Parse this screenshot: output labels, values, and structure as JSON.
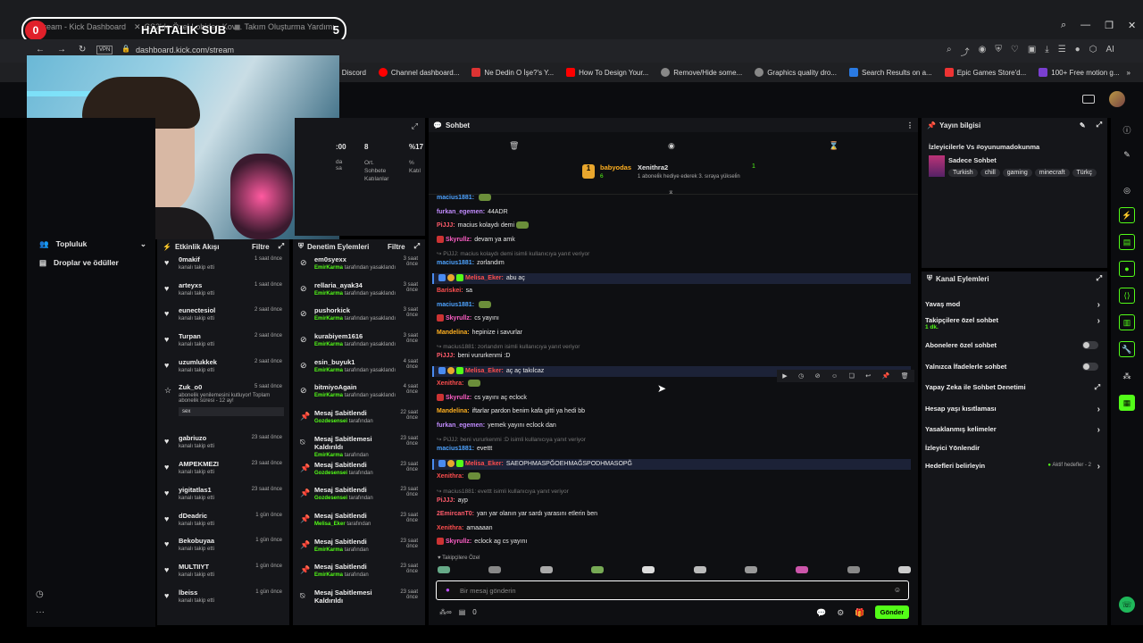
{
  "browser": {
    "tabs": [
      "stream - Kick Dashboard",
      "CS2'de Özel Lobiden Kov...",
      "Takım Oluşturma Yardımı"
    ],
    "url": "dashboard.kick.com/stream",
    "vpn_label": "VPN",
    "ai_label": "AI",
    "bookmarks": [
      "Discord",
      "Channel dashboard...",
      "Ne Dedin O İşe?'s Y...",
      "How To Design Your...",
      "Remove/Hide some...",
      "Graphics quality dro...",
      "Search Results on a...",
      "Epic Games Store'd...",
      "100+ Free motion g..."
    ]
  },
  "overlay": {
    "sub_count": "0",
    "label": "HAFTALIK SUB",
    "target": "5"
  },
  "stats": {
    "values": [
      ":00",
      "8",
      "%17"
    ],
    "labels": [
      "da\nsa",
      "Ort.\nSohbete\nKatılanlar",
      "%\nKatıl"
    ]
  },
  "left_nav": {
    "items": [
      "Topluluk",
      "Droplar ve ödüller"
    ]
  },
  "activity": {
    "title": "Etkinlik Akışı",
    "filter": "Filtre",
    "rows": [
      {
        "name": "0makif",
        "sub": "kanalı takip etti",
        "time": "1 saat önce"
      },
      {
        "name": "arteyxs",
        "sub": "kanalı takip etti",
        "time": "1 saat önce"
      },
      {
        "name": "eunectesiol",
        "sub": "kanalı takip etti",
        "time": "2 saat önce"
      },
      {
        "name": "Turpan",
        "sub": "kanalı takip etti",
        "time": "2 saat önce"
      },
      {
        "name": "uzumlukkek",
        "sub": "kanalı takip etti",
        "time": "2 saat önce"
      },
      {
        "name": "Zuk_o0",
        "sub": "abonelik yenilemesini kutluyor! Toplam abonelik süresi - 12 ay!",
        "time": "5 saat önce",
        "extra": "sex"
      },
      {
        "name": "gabriuzo",
        "sub": "kanalı takip etti",
        "time": "23 saat önce"
      },
      {
        "name": "AMPEKMEZI",
        "sub": "kanalı takip etti",
        "time": "23 saat önce"
      },
      {
        "name": "yigitatlas1",
        "sub": "kanalı takip etti",
        "time": "23 saat önce"
      },
      {
        "name": "dDeadric",
        "sub": "kanalı takip etti",
        "time": "1 gün önce"
      },
      {
        "name": "Bekobuyaa",
        "sub": "kanalı takip etti",
        "time": "1 gün önce"
      },
      {
        "name": "MULTIIYT",
        "sub": "kanalı takip etti",
        "time": "1 gün önce"
      },
      {
        "name": "lbeiss",
        "sub": "kanalı takip etti",
        "time": "1 gün önce"
      }
    ]
  },
  "moderation": {
    "title": "Denetim Eylemleri",
    "filter": "Filtre",
    "rows": [
      {
        "name": "em0syexx",
        "mod": "EmirKarma",
        "sub": "tarafından yasaklandı",
        "time": "3 saat önce",
        "icon": "ban"
      },
      {
        "name": "rellaria_ayak34",
        "mod": "EmirKarma",
        "sub": "tarafından yasaklandı",
        "time": "3 saat önce",
        "icon": "ban"
      },
      {
        "name": "pushorkick",
        "mod": "EmirKarma",
        "sub": "tarafından yasaklandı",
        "time": "3 saat önce",
        "icon": "ban"
      },
      {
        "name": "kurabiyem1616",
        "mod": "EmirKarma",
        "sub": "tarafından yasaklandı",
        "time": "3 saat önce",
        "icon": "ban"
      },
      {
        "name": "esin_buyuk1",
        "mod": "EmirKarma",
        "sub": "tarafından yasaklandı",
        "time": "4 saat önce",
        "icon": "ban"
      },
      {
        "name": "bitmiyoAgain",
        "mod": "EmirKarma",
        "sub": "tarafından yasaklandı",
        "time": "4 saat önce",
        "icon": "ban"
      },
      {
        "name": "Mesaj Sabitlendi",
        "mod": "Gozdesensei",
        "sub": "tarafından",
        "time": "22 saat önce",
        "icon": "pin"
      },
      {
        "name": "Mesaj Sabitlemesi Kaldırıldı",
        "mod": "EmirKarma",
        "sub": "tarafından",
        "time": "23 saat önce",
        "icon": "unpin"
      },
      {
        "name": "Mesaj Sabitlendi",
        "mod": "Gozdesensei",
        "sub": "tarafından",
        "time": "23 saat önce",
        "icon": "pin"
      },
      {
        "name": "Mesaj Sabitlendi",
        "mod": "Gozdesensei",
        "sub": "tarafından",
        "time": "23 saat önce",
        "icon": "pin"
      },
      {
        "name": "Mesaj Sabitlendi",
        "mod": "Melisa_Eker",
        "sub": "tarafından",
        "time": "23 saat önce",
        "icon": "pin"
      },
      {
        "name": "Mesaj Sabitlendi",
        "mod": "EmirKarma",
        "sub": "tarafından",
        "time": "23 saat önce",
        "icon": "pin"
      },
      {
        "name": "Mesaj Sabitlendi",
        "mod": "EmirKarma",
        "sub": "tarafından",
        "time": "23 saat önce",
        "icon": "pin"
      },
      {
        "name": "Mesaj Sabitlemesi Kaldırıldı",
        "mod": "",
        "sub": "",
        "time": "23 saat önce",
        "icon": "unpin"
      }
    ]
  },
  "chat": {
    "title": "Sohbet",
    "pinned": {
      "user": "babyodas",
      "count": "6",
      "gifted_user": "Xenithra2",
      "gift_count": "1",
      "text": "1 aboneli̇k hediye ederek 3. sıraya yükseli̇n"
    },
    "messages": [
      {
        "user": "macius1881:",
        "text": "",
        "color": "#4ea3ff",
        "emote": true
      },
      {
        "user": "furkan_egemen:",
        "text": "44ADR",
        "color": "#c28cff"
      },
      {
        "user": "PiJJJ:",
        "text": "macius kolaydı demi",
        "color": "#ff5b6b",
        "emote": true
      },
      {
        "user": "Skyrullz:",
        "text": "devam ya amk",
        "color": "#ff5fc6",
        "badge": true
      },
      {
        "reply": "PiJJJ: macius kolaydı demi  isimli kullanıcıya yanıt veriyor"
      },
      {
        "user": "macius1881:",
        "text": "zorlandım",
        "color": "#4ea3ff"
      },
      {
        "user": "Melisa_Eker:",
        "text": "abu aç",
        "color": "#ff4e4e",
        "hl": true
      },
      {
        "user": "Bariskei:",
        "text": "sa",
        "color": "#ff4e4e"
      },
      {
        "user": "macius1881:",
        "text": "",
        "color": "#4ea3ff",
        "emote": true
      },
      {
        "user": "Skyrullz:",
        "text": "cs yayını",
        "color": "#ff5fc6",
        "badge": true
      },
      {
        "user": "Mandelina:",
        "text": "hepinize i savurlar",
        "color": "#ffb020"
      },
      {
        "reply": "macius1881: zorlandım isimli kullanıcıya yanıt veriyor"
      },
      {
        "user": "PiJJJ:",
        "text": "beni vururkenmi :D",
        "color": "#ff5b6b"
      },
      {
        "user": "Melisa_Eker:",
        "text": "aç aç takılcaz",
        "color": "#ff4e4e",
        "hl": true
      },
      {
        "user": "Xenithra:",
        "text": "",
        "color": "#ff4e4e",
        "emote": true
      },
      {
        "user": "Skyrullz:",
        "text": "cs yayını aç eclock",
        "color": "#ff5fc6",
        "badge": true
      },
      {
        "user": "Mandelina:",
        "text": "iftarlar pardon benim kafa gitti ya hedi bb",
        "color": "#ffb020"
      },
      {
        "user": "furkan_egemen:",
        "text": "yemek yayını eclock dan",
        "color": "#c28cff"
      },
      {
        "reply": "PiJJJ: beni vururkenmi :D isimli kullanıcıya yanıt veriyor"
      },
      {
        "user": "macius1881:",
        "text": "evettt",
        "color": "#4ea3ff"
      },
      {
        "user": "Melisa_Eker:",
        "text": "SAEOPHMASPĞOEHMAĞSPODHMASOPĞ",
        "color": "#ff4e4e",
        "hl": true
      },
      {
        "user": "Xenithra:",
        "text": "",
        "color": "#ff4e4e",
        "emote": true
      },
      {
        "reply": "macius1881: evettt isimli kullanıcıya yanıt veriyor"
      },
      {
        "user": "PiJJJ:",
        "text": "ayp",
        "color": "#ff5b6b"
      },
      {
        "user": "2EmircanT0:",
        "text": "yarı yar olanın yar sardı yarasını etlerin ben",
        "color": "#ff5b6b"
      },
      {
        "user": "Xenithra:",
        "text": "amaaaan",
        "color": "#ff4e4e"
      },
      {
        "user": "Skyrullz:",
        "text": "eclock ag cs yayını",
        "color": "#ff5fc6",
        "badge": true
      }
    ],
    "followers_only": "Takipçilere Özel",
    "input_placeholder": "Bir mesaj gönderin",
    "count": "0",
    "send": "Gönder"
  },
  "stream_info": {
    "title": "Yayın bilgisi",
    "stream_title": "İzleyicilerle Vs #oyunumadokunma",
    "category": "Sadece Sohbet",
    "tags": [
      "Turkish",
      "chill",
      "gaming",
      "minecraft",
      "Türkç"
    ]
  },
  "channel_actions": {
    "title": "Kanal Eylemleri",
    "items": [
      {
        "label": "Yavaş mod",
        "type": "chevron"
      },
      {
        "label": "Takipçilere özel sohbet",
        "sub": "1 dk.",
        "type": "chevron"
      },
      {
        "label": "Abonelere özel sohbet",
        "type": "toggle"
      },
      {
        "label": "Yalnızca İfadelerle sohbet",
        "type": "toggle"
      },
      {
        "label": "Yapay Zeka ile Sohbet Denetimi",
        "type": "ext"
      },
      {
        "label": "Hesap yaşı kısıtlaması",
        "type": "chevron"
      },
      {
        "label": "Yasaklanmış kelimeler",
        "type": "chevron"
      },
      {
        "label": "İzleyici Yönlendir",
        "type": "none"
      },
      {
        "label": "Hedefleri belirleyin",
        "type": "goal",
        "sub": "Aktif hedefler - 2"
      }
    ]
  },
  "colors": {
    "kick_green": "#53fc18",
    "bg": "#0b0c0f",
    "panel": "#15161a"
  }
}
